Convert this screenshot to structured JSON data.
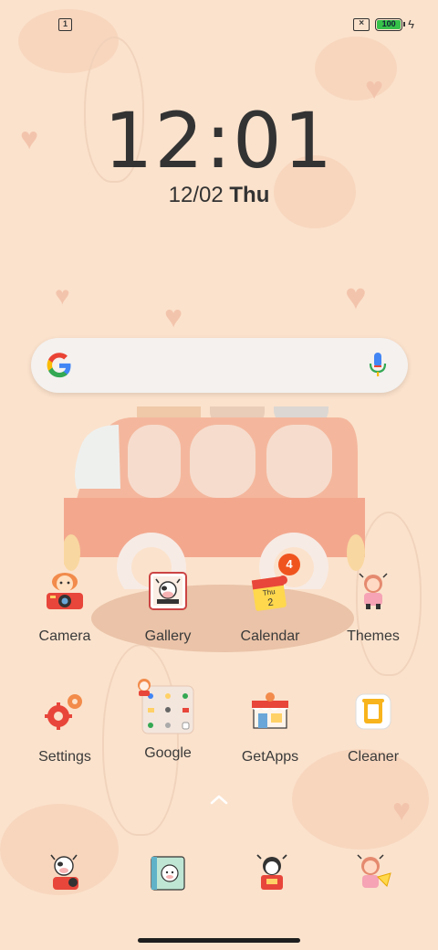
{
  "status_bar": {
    "notification_count": "1",
    "sim_status": "no-sim",
    "battery_level": "100",
    "charging": true
  },
  "clock": {
    "time": "12:01",
    "date": "12/02",
    "weekday": "Thu"
  },
  "search": {
    "logo": "google-g-icon",
    "voice": "mic-icon"
  },
  "apps": [
    {
      "label": "Camera",
      "icon": "camera-icon"
    },
    {
      "label": "Gallery",
      "icon": "gallery-icon"
    },
    {
      "label": "Calendar",
      "icon": "calendar-icon",
      "badge": "4",
      "calendar_day": "Thu",
      "calendar_date": "2"
    },
    {
      "label": "Themes",
      "icon": "themes-icon"
    },
    {
      "label": "Settings",
      "icon": "settings-icon"
    },
    {
      "label": "Google",
      "icon": "google-folder-icon"
    },
    {
      "label": "GetApps",
      "icon": "getapps-icon"
    },
    {
      "label": "Cleaner",
      "icon": "cleaner-icon"
    }
  ],
  "dock": [
    {
      "icon": "phone-icon"
    },
    {
      "icon": "contacts-icon"
    },
    {
      "icon": "messages-icon"
    },
    {
      "icon": "browser-icon"
    }
  ],
  "colors": {
    "wallpaper": "#fbe2cc",
    "badge": "#f0541e",
    "battery": "#36c24a"
  }
}
